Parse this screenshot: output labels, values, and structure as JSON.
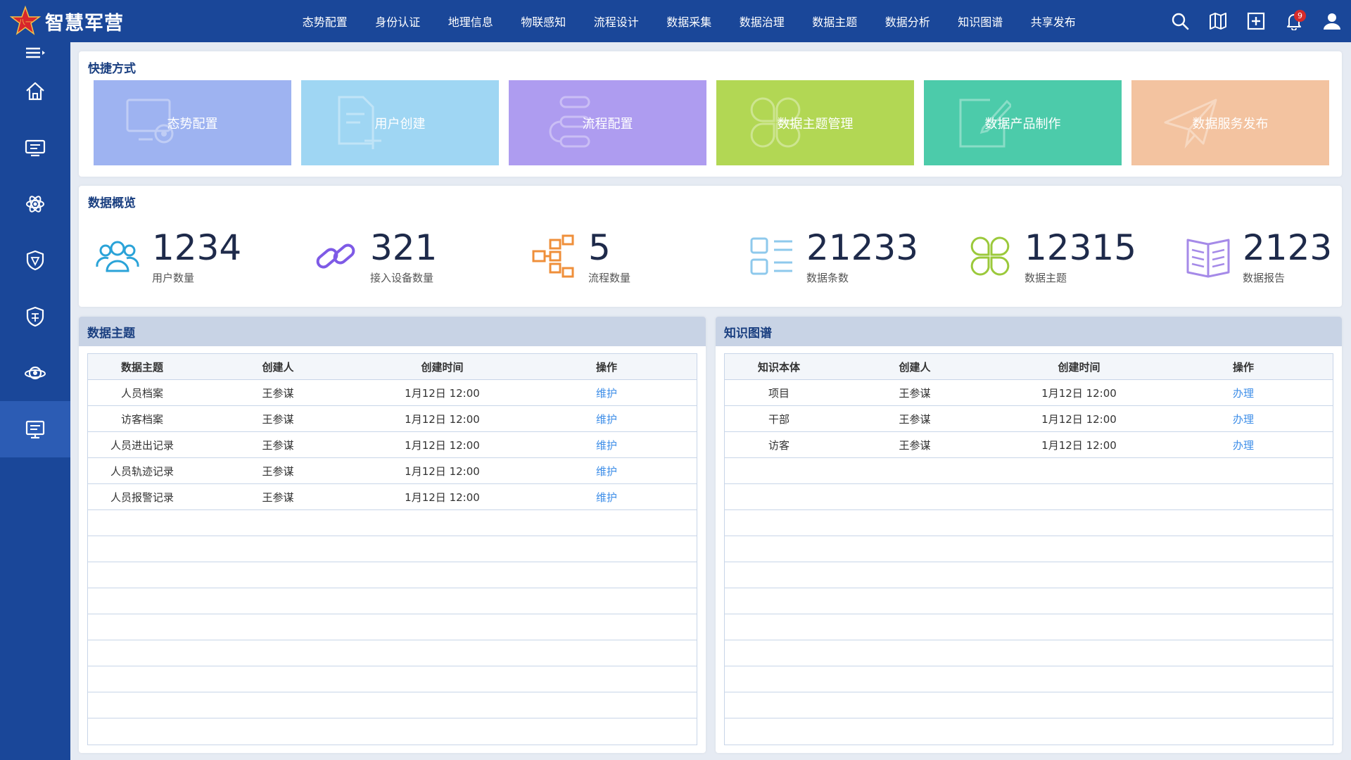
{
  "app": {
    "title": "智慧军营"
  },
  "nav": [
    "态势配置",
    "身份认证",
    "地理信息",
    "物联感知",
    "流程设计",
    "数据采集",
    "数据治理",
    "数据主题",
    "数据分析",
    "知识图谱",
    "共享发布"
  ],
  "top_icons": {
    "notifications_count": "9"
  },
  "shortcuts": {
    "title": "快捷方式",
    "tiles": [
      {
        "label": "态势配置",
        "color": "#9eb3f1",
        "icon": "monitor-gear-icon"
      },
      {
        "label": "用户创建",
        "color": "#9fd6f3",
        "icon": "document-plus-icon"
      },
      {
        "label": "流程配置",
        "color": "#ae9cf0",
        "icon": "flow-icon"
      },
      {
        "label": "数据主题管理",
        "color": "#b2d754",
        "icon": "four-petal-icon"
      },
      {
        "label": "数据产品制作",
        "color": "#4ccbaa",
        "icon": "edit-icon"
      },
      {
        "label": "数据服务发布",
        "color": "#f3c3a0",
        "icon": "paper-plane-icon"
      }
    ]
  },
  "overview": {
    "title": "数据概览",
    "stats": [
      {
        "value": "1234",
        "label": "用户数量",
        "icon": "users-icon",
        "color": "#2aa3d8"
      },
      {
        "value": "321",
        "label": "接入设备数量",
        "icon": "link-icon",
        "color": "#7e5ae6"
      },
      {
        "value": "5",
        "label": "流程数量",
        "icon": "hierarchy-icon",
        "color": "#ef8f3a"
      },
      {
        "value": "21233",
        "label": "数据条数",
        "icon": "list-icon",
        "color": "#8ec9ec"
      },
      {
        "value": "12315",
        "label": "数据主题",
        "icon": "four-petal-icon",
        "color": "#9bc93b"
      },
      {
        "value": "2123",
        "label": "数据报告",
        "icon": "book-icon",
        "color": "#a58ae8"
      }
    ]
  },
  "data_topics": {
    "title": "数据主题",
    "columns": [
      "数据主题",
      "创建人",
      "创建时间",
      "操作"
    ],
    "rows": [
      [
        "人员档案",
        "王参谋",
        "1月12日 12:00",
        "维护"
      ],
      [
        "访客档案",
        "王参谋",
        "1月12日 12:00",
        "维护"
      ],
      [
        "人员进出记录",
        "王参谋",
        "1月12日 12:00",
        "维护"
      ],
      [
        "人员轨迹记录",
        "王参谋",
        "1月12日 12:00",
        "维护"
      ],
      [
        "人员报警记录",
        "王参谋",
        "1月12日 12:00",
        "维护"
      ]
    ]
  },
  "knowledge_graph": {
    "title": "知识图谱",
    "columns": [
      "知识本体",
      "创建人",
      "创建时间",
      "操作"
    ],
    "rows": [
      [
        "项目",
        "王参谋",
        "1月12日 12:00",
        "办理"
      ],
      [
        "干部",
        "王参谋",
        "1月12日 12:00",
        "办理"
      ],
      [
        "访客",
        "王参谋",
        "1月12日 12:00",
        "办理"
      ]
    ]
  }
}
